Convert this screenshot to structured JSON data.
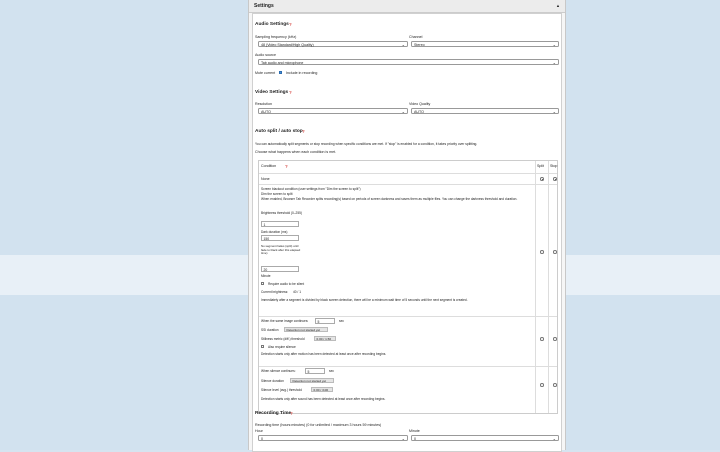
{
  "header": {
    "title": "Settings",
    "caret": "▲"
  },
  "audio": {
    "title": "Audio Settings",
    "help": "?",
    "sampling_label": "Sampling frequency (kHz)",
    "sampling_value": "48 (Video Standard/High Quality)",
    "channel_label": "Channel",
    "channel_value": "Stereo",
    "source_label": "Audio source",
    "source_value": "Tab audio and microphone",
    "mute_label": "Mute current",
    "mute_checked": true,
    "include_label": "Include in recording"
  },
  "video": {
    "title": "Video Settings",
    "help": "?",
    "resolution_label": "Resolution",
    "resolution_value": "AUTO",
    "quality_label": "Video Quality",
    "quality_value": "AUTO"
  },
  "autosplit": {
    "title": "Auto split / auto stop",
    "help": "?",
    "desc": "You can automatically split segments or stop recording when specific conditions are met. If \"stop\" is enabled for a condition, it takes priority over splitting.",
    "choose": "Choose what happens when each condition is met.",
    "col_condition": "Condition",
    "col_help": "?",
    "col_split": "Split",
    "col_stop": "Stop",
    "none_label": "None",
    "screen": {
      "line1": "Screen blackout condition (user settings from \"Dim the screen to split\")",
      "line2": "Dim the screen to split",
      "line3": "When enabled, Browser Tab Recorder splits recording(s) based on periods of screen darkness and saves them as multiple files. You can change the darkness threshold and duration.",
      "brightness_label": "Brightness threshold (0–255)",
      "brightness_value": "1",
      "duration_label": "Dark duration (ms)",
      "duration_value": "150",
      "no_segment_label": "No segment fades (split) until fade to black after this elapsed time)",
      "no_segment_value": "20",
      "minute": "Minute",
      "require_label": "Require audio to be silent",
      "current_label": "Current brightness:",
      "current_value": "40 / 1",
      "immediately": "Immediately after a segment is divided by black screen detection, there will be a minimum wait time of 5 seconds until the next segment is created."
    },
    "image": {
      "when_label": "When the same image continues:",
      "when_value": "5",
      "unit": "sec",
      "ssi_label": "SSI duration",
      "ssi_status": "Detection not started yet",
      "stillness_label": "Stillness metric (diff.) threshold",
      "stillness_value": "0.00 / 1.50",
      "also_label": "Also require silence",
      "note": "Detection starts only after motion has been detected at least once after recording begins."
    },
    "silence": {
      "when_label": "When silence continues:",
      "when_value": "5",
      "unit": "sec",
      "dur_label": "Silence duration",
      "dur_status": "Detection not started yet",
      "level_label": "Silence level (avg.) threshold",
      "level_value": "0.00 / 3.00",
      "note": "Detection starts only after sound has been detected at least once after recording begins."
    }
  },
  "rectime": {
    "title": "Recording Time",
    "help": "?",
    "desc": "Recording time (hours:minutes) (0 for unlimited / maximum 3 hours 59 minutes)",
    "hour_label": "Hour",
    "hour_value": "0",
    "minute_label": "Minute",
    "minute_value": "0"
  }
}
